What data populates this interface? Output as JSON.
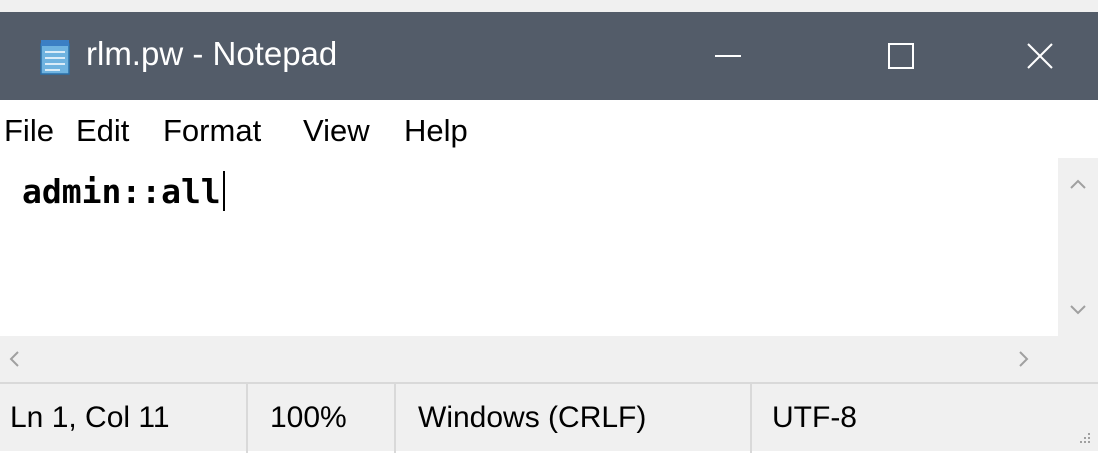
{
  "window": {
    "title": "rlm.pw - Notepad",
    "icon": "notepad-icon",
    "controls": {
      "minimize": "minimize-icon",
      "maximize": "maximize-icon",
      "close": "close-icon"
    }
  },
  "menu": {
    "items": [
      {
        "label": "File"
      },
      {
        "label": "Edit"
      },
      {
        "label": "Format"
      },
      {
        "label": "View"
      },
      {
        "label": "Help"
      }
    ]
  },
  "editor": {
    "content": "admin::all"
  },
  "statusbar": {
    "position": "Ln 1, Col 11",
    "zoom": "100%",
    "line_ending": "Windows (CRLF)",
    "encoding": "UTF-8"
  },
  "colors": {
    "titlebar": "#535c69",
    "menubar": "#ffffff",
    "chrome": "#f0f0f0"
  }
}
